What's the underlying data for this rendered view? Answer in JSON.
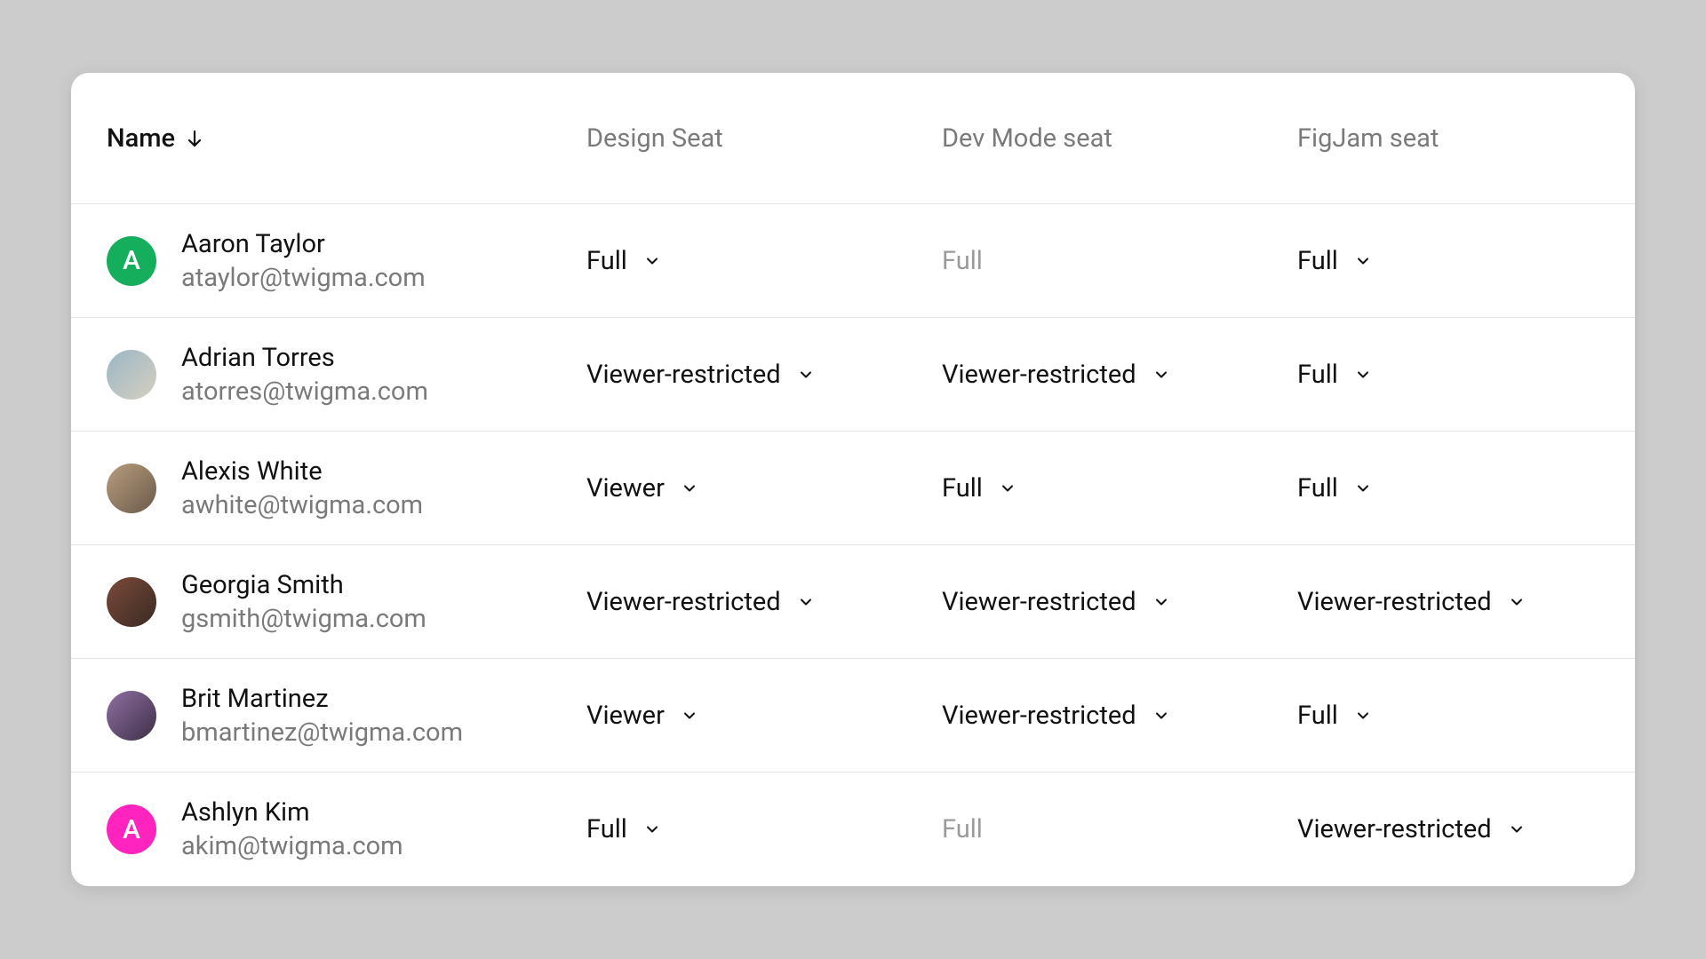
{
  "columns": {
    "name": "Name",
    "design": "Design Seat",
    "dev": "Dev Mode seat",
    "figjam": "FigJam seat"
  },
  "sort_direction": "down",
  "users": [
    {
      "name": "Aaron Taylor",
      "email": "ataylor@twigma.com",
      "avatar": {
        "type": "letter",
        "letter": "A",
        "bg": "#14ae5c"
      },
      "design": {
        "label": "Full",
        "editable": true
      },
      "dev": {
        "label": "Full",
        "editable": false
      },
      "figjam": {
        "label": "Full",
        "editable": true
      }
    },
    {
      "name": "Adrian Torres",
      "email": "atorres@twigma.com",
      "avatar": {
        "type": "photo",
        "bg1": "#9ab7c4",
        "bg2": "#d6cfc1"
      },
      "design": {
        "label": "Viewer-restricted",
        "editable": true
      },
      "dev": {
        "label": "Viewer-restricted",
        "editable": true
      },
      "figjam": {
        "label": "Full",
        "editable": true
      }
    },
    {
      "name": "Alexis White",
      "email": "awhite@twigma.com",
      "avatar": {
        "type": "photo",
        "bg1": "#b79d7e",
        "bg2": "#6b5a49"
      },
      "design": {
        "label": "Viewer",
        "editable": true
      },
      "dev": {
        "label": "Full",
        "editable": true
      },
      "figjam": {
        "label": "Full",
        "editable": true
      }
    },
    {
      "name": "Georgia Smith",
      "email": "gsmith@twigma.com",
      "avatar": {
        "type": "photo",
        "bg1": "#7a4a3a",
        "bg2": "#3a2a22"
      },
      "design": {
        "label": "Viewer-restricted",
        "editable": true
      },
      "dev": {
        "label": "Viewer-restricted",
        "editable": true
      },
      "figjam": {
        "label": "Viewer-restricted",
        "editable": true
      }
    },
    {
      "name": "Brit Martinez",
      "email": "bmartinez@twigma.com",
      "avatar": {
        "type": "photo",
        "bg1": "#8f6fa3",
        "bg2": "#3d2f46"
      },
      "design": {
        "label": "Viewer",
        "editable": true
      },
      "dev": {
        "label": "Viewer-restricted",
        "editable": true
      },
      "figjam": {
        "label": "Full",
        "editable": true
      }
    },
    {
      "name": "Ashlyn Kim",
      "email": "akim@twigma.com",
      "avatar": {
        "type": "letter",
        "letter": "A",
        "bg": "#ff24bd"
      },
      "design": {
        "label": "Full",
        "editable": true
      },
      "dev": {
        "label": "Full",
        "editable": false
      },
      "figjam": {
        "label": "Viewer-restricted",
        "editable": true
      }
    }
  ]
}
